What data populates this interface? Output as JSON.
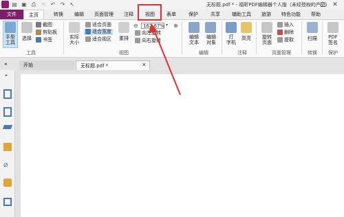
{
  "app": {
    "title": "无标题.pdf * - 福昕PDF编辑器个人版（未经授权的产品）"
  },
  "menu": {
    "items": [
      "文件",
      "主页",
      "转换",
      "编辑",
      "页面管理",
      "注释",
      "视图",
      "表单",
      "保护",
      "共享",
      "辅助工具",
      "旅游",
      "特色功能",
      "帮助"
    ]
  },
  "ribbon": {
    "hand_tool": "手型\n工具",
    "select": "选择",
    "screenshot": "截图",
    "clipboard": "剪贴板",
    "bookmark": "书签",
    "actual_size": "实际\n大小",
    "fit_page": "适合页面",
    "fit_width": "适合宽度",
    "fit_visible": "适合视区",
    "reflow": "重排",
    "zoom_value": "162.67%",
    "rotate_left": "向左旋转",
    "rotate_right": "向右旋转",
    "edit_text": "编辑\n文本",
    "edit_object": "编辑\n对象",
    "typewriter": "打\n字机",
    "highlight": "高亮",
    "rotate_page": "旋转\n页面",
    "insert": "插入",
    "delete": "删除",
    "extract": "提取",
    "scan": "扫描",
    "pdf_sign": "PDF\n签名",
    "groups": {
      "tools": "工具",
      "view": "视图",
      "edit": "编辑",
      "comment": "注释",
      "page_mgmt": "页面管理",
      "convert": "转换",
      "protect": "保护"
    }
  },
  "tabs": {
    "start": "开始",
    "document": "无标题.pdf *"
  },
  "colors": {
    "brand": "#7b1f6b",
    "highlight": "#e53030"
  },
  "icons": {
    "sidebar": [
      "bookmark-icon",
      "pages-icon",
      "layers-icon",
      "comments-icon",
      "attachment-icon",
      "lock-icon",
      "form-icon"
    ]
  }
}
